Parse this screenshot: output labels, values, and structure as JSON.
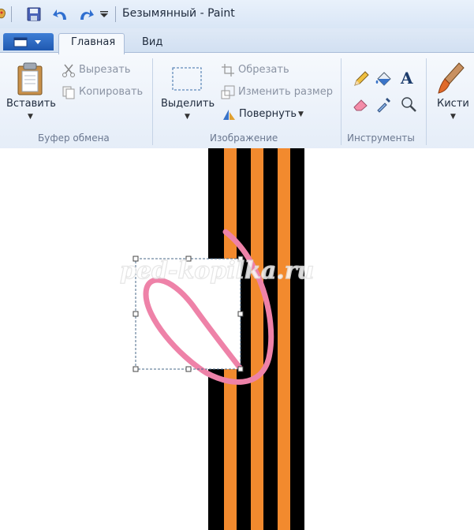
{
  "window": {
    "title": "Безымянный - Paint"
  },
  "tabs": {
    "home": "Главная",
    "view": "Вид"
  },
  "clipboard": {
    "paste": "Вставить",
    "cut": "Вырезать",
    "copy": "Копировать",
    "group": "Буфер обмена"
  },
  "image": {
    "select": "Выделить",
    "crop": "Обрезать",
    "resize": "Изменить размер",
    "rotate": "Повернуть",
    "group": "Изображение"
  },
  "tools": {
    "group": "Инструменты",
    "text_glyph": "A"
  },
  "brushes": {
    "label": "Кисти"
  },
  "watermark": "ped-kopilka.ru",
  "colors": {
    "ribbon_stripe_black": "#000000",
    "ribbon_stripe_orange": "#f28a2e",
    "drawn_stroke": "#ee82a8",
    "selection_border": "#4a6a8a"
  }
}
